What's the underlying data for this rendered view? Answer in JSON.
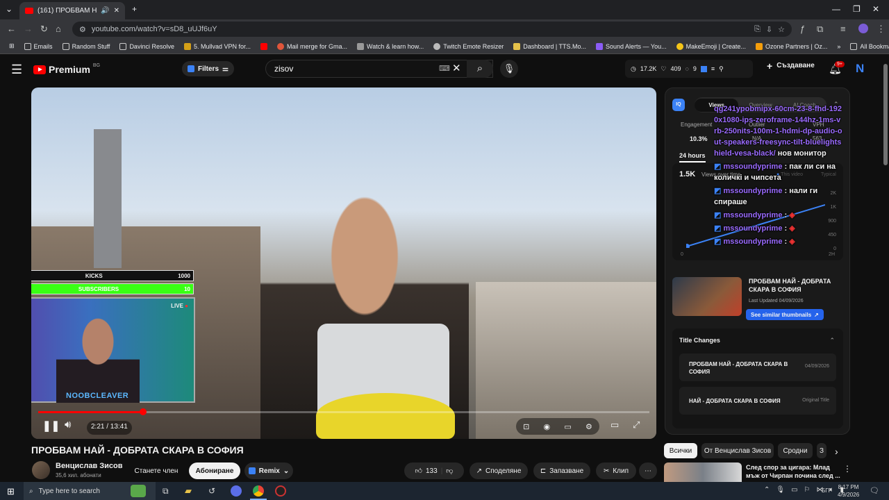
{
  "browser": {
    "tab_title": "(161) ПРОБВАМ НАЙ - ДО",
    "url": "youtube.com/watch?v=sD8_uUJf6uY",
    "bookmarks": [
      "Emails",
      "Random Stuff",
      "Davinci Resolve",
      "5. Mullvad VPN for...",
      "Mail merge for Gma...",
      "Watch & learn how...",
      "Twitch Emote Resizer",
      "Dashboard | TTS.Mo...",
      "Sound Alerts — You...",
      "MakeEmoji | Create...",
      "Ozone Partners | Oz..."
    ],
    "all_bookmarks": "All Bookmarks"
  },
  "youtube": {
    "logo": "Premium",
    "region": "BG",
    "filters": "Filters",
    "search_query": "zisov",
    "stats": [
      "17.2K",
      "409",
      "9"
    ],
    "create": "Създаване",
    "notif_count": "9+",
    "avatar_letter": "N"
  },
  "overlay": {
    "kicks_left": "0",
    "kicks_label": "KICKS",
    "kicks_right": "1000",
    "subs_left": "10",
    "subs_label": "SUBSCRIBERS",
    "subs_right": "10",
    "live": "LIVE",
    "streamer": "NOOBCLEAVER"
  },
  "player": {
    "time": "2:21 / 13:41",
    "progress": 0.172
  },
  "panel": {
    "tabs": [
      "Views",
      "Overview",
      "AI Coach"
    ],
    "engagement": "Engagement",
    "outlier": "Outlier",
    "vph": "VPH",
    "eng_val": "10.3%",
    "outlier_val": "N/A",
    "vph_val": "563",
    "period": "24 hours",
    "views_count": "1.5K",
    "views_over_time": "Views over time",
    "this_video": "This video",
    "typical": "Typical",
    "y_ticks": [
      "2K",
      "1K",
      "900",
      "450",
      "0"
    ],
    "x_start": "0",
    "x_end": "2H",
    "chat": [
      {
        "user": "",
        "text": "qg241ypobmipx-60cm-23-8-fhd-1920x1080-ips-zeroframe-144hz-1ms-vrb-250nits-100m-1-hdmi-dp-audio-out-speakers-freesync-tilt-bluelightshield-vesa-black/",
        "tail": " нов монитор"
      },
      {
        "user": "mssoundyprime",
        "text": "пак ли си на количкi и чипсета"
      },
      {
        "user": "mssoundyprime",
        "text": "нали ги спираше"
      },
      {
        "user": "mssoundyprime",
        "text": ""
      },
      {
        "user": "mssoundyprime",
        "text": ""
      },
      {
        "user": "mssoundyprime",
        "text": ""
      }
    ],
    "card_title": "ПРОБВАМ НАЙ - ДОБРАТА СКАРА В СОФИЯ",
    "card_updated": "Last Updated 04/09/2026",
    "similar_btn": "See similar thumbnails",
    "title_changes": "Title Changes",
    "changes": [
      {
        "title": "ПРОБВАМ НАЙ - ДОБРАТА СКАРА В СОФИЯ",
        "date": "04/09/2026"
      },
      {
        "title": "НАЙ - ДОБРАТА СКАРА В СОФИЯ",
        "date": "Original Title"
      }
    ]
  },
  "video": {
    "title": "ПРОБВАМ НАЙ - ДОБРАТА СКАРА В СОФИЯ",
    "channel": "Венцислав Зисов",
    "subs": "35,6 хил. абонати",
    "join": "Станете член",
    "subscribe": "Абониране",
    "remix": "Remix",
    "likes": "133",
    "share": "Споделяне",
    "save": "Запазване",
    "clip": "Клип"
  },
  "chips": [
    "Всички",
    "От Венцислав Зисов",
    "Сродни",
    "З"
  ],
  "rec": {
    "title": "След спор за цигара: Млад мъж от Чирпан почина след ..."
  },
  "taskbar": {
    "search": "Type here to search",
    "lang": "БГР",
    "time": "8:17 PM",
    "date": "4/9/2026"
  },
  "colors": {
    "yt_red": "#ff0000",
    "accent_purple": "#9b6bff",
    "accent_blue": "#3b82f6",
    "subs_green": "#39ff14"
  }
}
